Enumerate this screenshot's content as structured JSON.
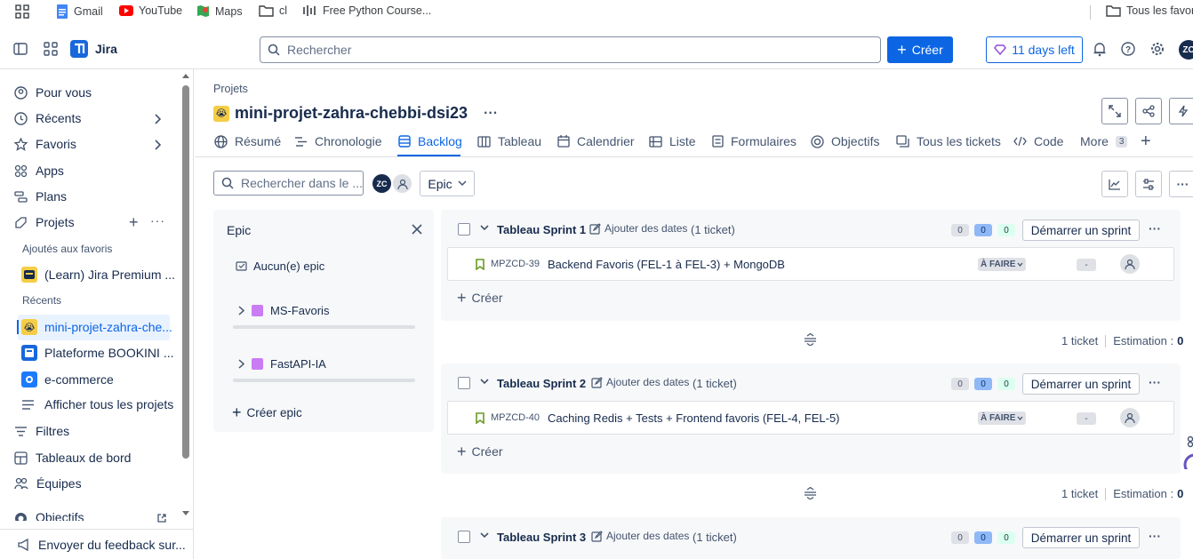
{
  "bookmarks": {
    "items": [
      "Gmail",
      "YouTube",
      "Maps",
      "cl",
      "Free Python Course..."
    ],
    "right": "Tous les favor"
  },
  "topbar": {
    "app_name": "Jira",
    "search_placeholder": "Rechercher",
    "create_label": "Créer",
    "trial_label": "11 days left",
    "avatar_initials": "ZC"
  },
  "sidebar": {
    "items": [
      "Pour vous",
      "Récents",
      "Favoris",
      "Apps",
      "Plans",
      "Projets"
    ],
    "favorites_heading": "Ajoutés aux favoris",
    "favorite_project": "(Learn) Jira Premium ...",
    "recent_heading": "Récents",
    "recent_projects": [
      "mini-projet-zahra-che...",
      "Plateforme BOOKINI ...",
      "e-commerce"
    ],
    "show_all": "Afficher tous les projets",
    "bottom_items": [
      "Filtres",
      "Tableaux de bord",
      "Équipes",
      "Objectifs"
    ],
    "feedback": "Envoyer du feedback sur..."
  },
  "project": {
    "breadcrumb": "Projets",
    "title": "mini-projet-zahra-chebbi-dsi23",
    "more": "···"
  },
  "tabs": [
    "Résumé",
    "Chronologie",
    "Backlog",
    "Tableau",
    "Calendrier",
    "Liste",
    "Formulaires",
    "Objectifs",
    "Tous les tickets",
    "Code",
    "More"
  ],
  "tabs_more_count": "3",
  "toolbar": {
    "search_placeholder": "Rechercher dans le ...",
    "avatar_initials": "ZC",
    "epic_filter": "Epic"
  },
  "epic_panel": {
    "title": "Epic",
    "none": "Aucun(e) epic",
    "epics": [
      {
        "name": "MS-Favoris",
        "color": "#c97cf4"
      },
      {
        "name": "FastAPI-IA",
        "color": "#c97cf4"
      }
    ],
    "create": "Créer epic"
  },
  "sprints": [
    {
      "name": "Tableau Sprint 1",
      "dates": "Ajouter des dates",
      "count": "(1 ticket)",
      "todo": "0",
      "inprog": "0",
      "done": "0",
      "start": "Démarrer un sprint",
      "issue": {
        "key": "MPZCD-39",
        "summary": "Backend Favoris (FEL-1 à FEL-3) + MongoDB",
        "status": "À FAIRE",
        "estimate": "-"
      },
      "create": "Créer",
      "footer_tickets": "1 ticket",
      "footer_estimation": "Estimation :",
      "footer_value": "0"
    },
    {
      "name": "Tableau Sprint 2",
      "dates": "Ajouter des dates",
      "count": "(1 ticket)",
      "todo": "0",
      "inprog": "0",
      "done": "0",
      "start": "Démarrer un sprint",
      "issue": {
        "key": "MPZCD-40",
        "summary": "Caching Redis + Tests + Frontend favoris (FEL-4, FEL-5)",
        "status": "À FAIRE",
        "estimate": "-"
      },
      "create": "Créer",
      "footer_tickets": "1 ticket",
      "footer_estimation": "Estimation :",
      "footer_value": "0"
    },
    {
      "name": "Tableau Sprint 3",
      "dates": "Ajouter des dates",
      "count": "(1 ticket)",
      "todo": "0",
      "inprog": "0",
      "done": "0",
      "start": "Démarrer un sprint"
    }
  ],
  "colors": {
    "accent": "#0c66e4",
    "pill_blue": "#8fb8f6",
    "pill_green": "#dcfff1"
  }
}
